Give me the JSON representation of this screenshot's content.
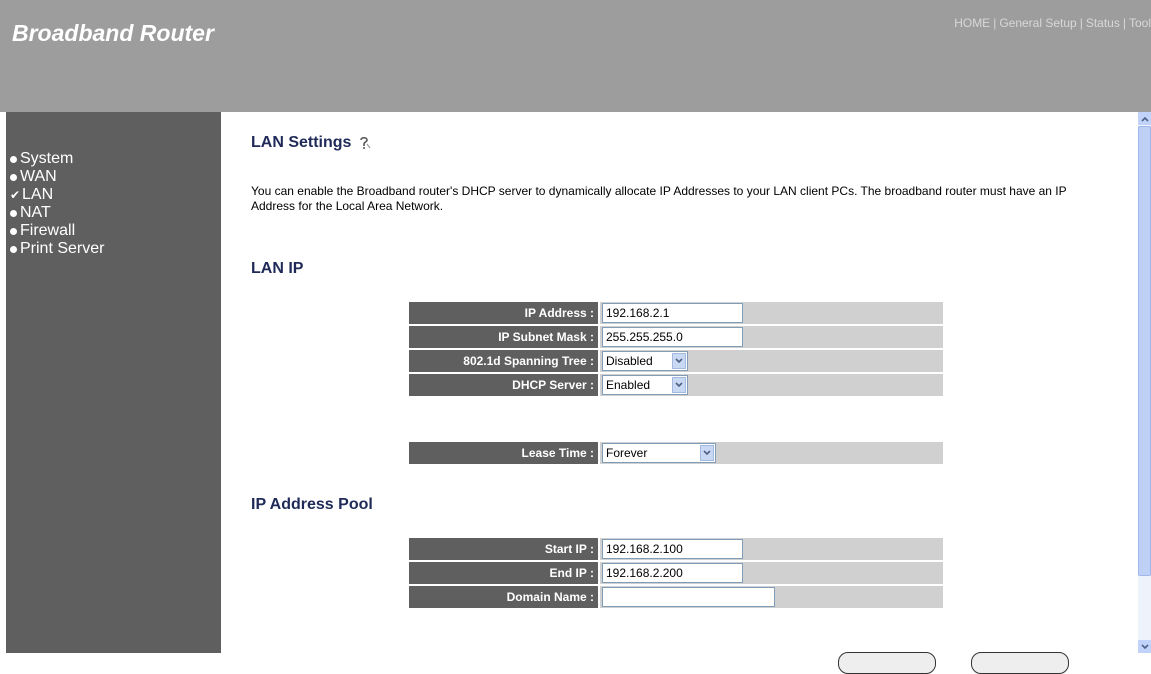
{
  "header": {
    "brand": "Broadband Router",
    "nav": [
      "HOME",
      "General Setup",
      "Status",
      "Tool"
    ],
    "nav_separator": "|"
  },
  "sidebar": {
    "items": [
      {
        "label": "System",
        "icon": "bullet-icon"
      },
      {
        "label": "WAN",
        "icon": "bullet-icon"
      },
      {
        "label": "LAN",
        "icon": "check-icon",
        "active": true
      },
      {
        "label": "NAT",
        "icon": "bullet-icon"
      },
      {
        "label": "Firewall",
        "icon": "bullet-icon"
      },
      {
        "label": "Print Server",
        "icon": "bullet-icon"
      }
    ]
  },
  "main": {
    "title": "LAN Settings",
    "description": "You can enable the Broadband router's DHCP server to dynamically allocate IP Addresses to your LAN client PCs. The broadband router must have an IP Address for the Local Area Network.",
    "lan_ip": {
      "heading": "LAN IP",
      "ip_address_label": "IP Address :",
      "ip_address_value": "192.168.2.1",
      "subnet_label": "IP Subnet Mask :",
      "subnet_value": "255.255.255.0",
      "stp_label": "802.1d Spanning Tree :",
      "stp_value": "Disabled",
      "dhcp_label": "DHCP Server :",
      "dhcp_value": "Enabled",
      "lease_label": "Lease Time :",
      "lease_value": "Forever"
    },
    "pool": {
      "heading": "IP Address Pool",
      "start_label": "Start IP :",
      "start_value": "192.168.2.100",
      "end_label": "End IP :",
      "end_value": "192.168.2.200",
      "domain_label": "Domain Name :",
      "domain_value": ""
    }
  },
  "colors": {
    "header_bg": "#9d9d9d",
    "sidebar_bg": "#5f5f5f",
    "heading": "#1f2a58",
    "label_cell": "#5f5f5f",
    "value_cell": "#d0d0d0"
  }
}
